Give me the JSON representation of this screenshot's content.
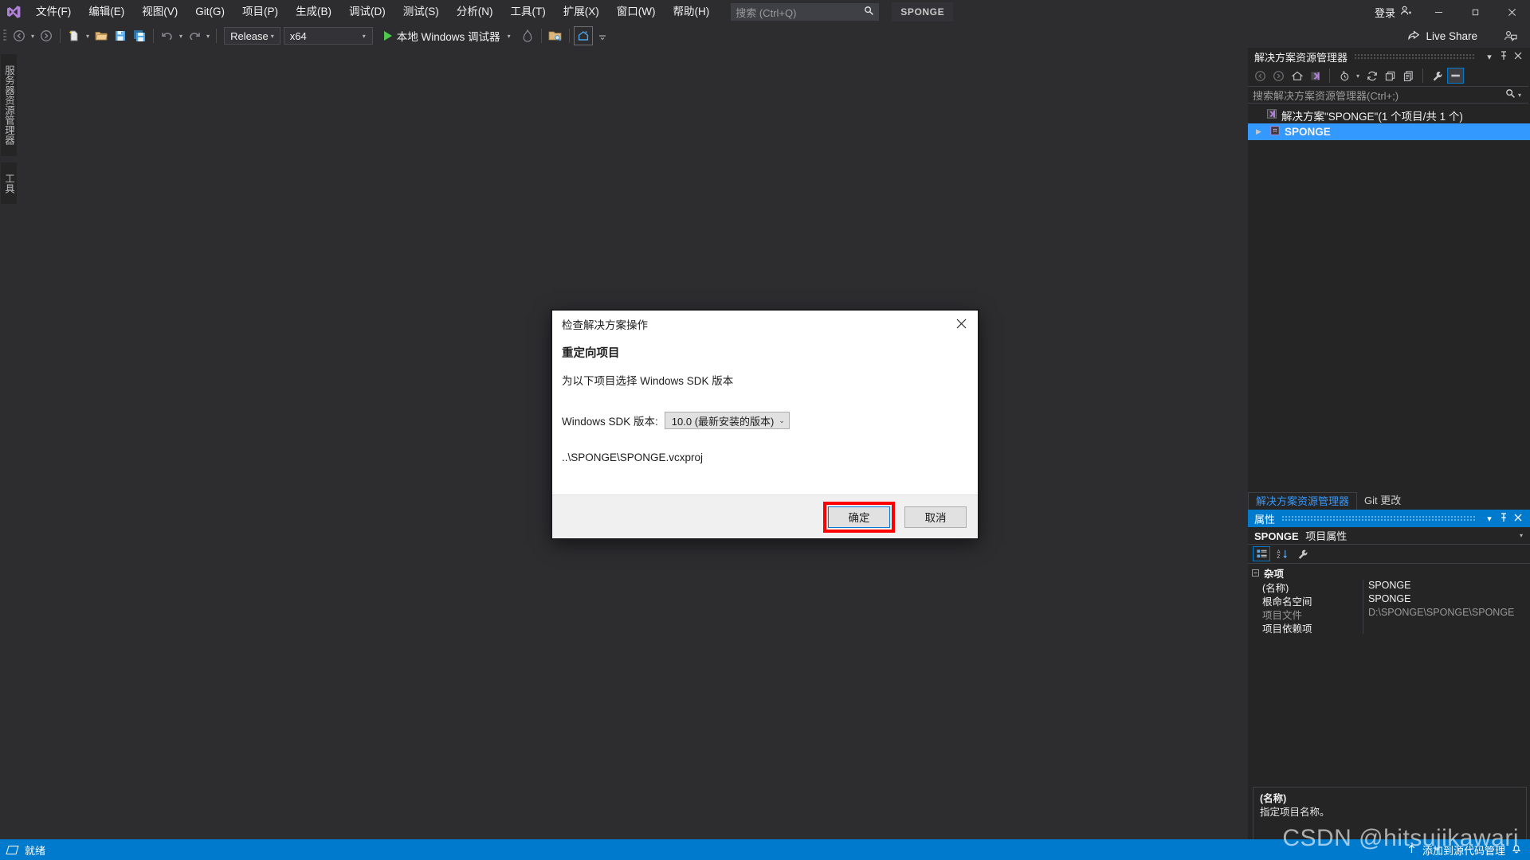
{
  "app": {
    "logo": "vs-logo",
    "project_pill": "SPONGE",
    "signin_label": "登录"
  },
  "menubar": {
    "items": [
      {
        "label": "文件(F)"
      },
      {
        "label": "编辑(E)"
      },
      {
        "label": "视图(V)"
      },
      {
        "label": "Git(G)"
      },
      {
        "label": "项目(P)"
      },
      {
        "label": "生成(B)"
      },
      {
        "label": "调试(D)"
      },
      {
        "label": "测试(S)"
      },
      {
        "label": "分析(N)"
      },
      {
        "label": "工具(T)"
      },
      {
        "label": "扩展(X)"
      },
      {
        "label": "窗口(W)"
      },
      {
        "label": "帮助(H)"
      }
    ]
  },
  "search": {
    "placeholder": "搜索 (Ctrl+Q)",
    "icon": "search-icon"
  },
  "window_controls": {
    "minimize": "—",
    "maximize": "❐",
    "close": "✕"
  },
  "toolbar": {
    "configuration": "Release",
    "platform": "x64",
    "run_label": "本地 Windows 调试器",
    "icons": [
      "back-icon",
      "forward-icon",
      "new-item-icon",
      "open-file-icon",
      "save-icon",
      "save-all-icon",
      "undo-icon",
      "redo-icon"
    ]
  },
  "live_share": {
    "label": "Live Share",
    "icon": "live-share-icon"
  },
  "left_rail": {
    "tabs": [
      {
        "label": "服务器资源管理器",
        "name": "server-explorer"
      },
      {
        "label": "工具箱",
        "name": "toolbox"
      }
    ]
  },
  "solution_explorer": {
    "title": "解决方案资源管理器",
    "search_placeholder": "搜索解决方案资源管理器(Ctrl+;)",
    "toolbar_icons": [
      "back-icon",
      "forward-icon",
      "home-icon",
      "switch-views-icon",
      "pending-changes-icon",
      "refresh-icon",
      "collapse-all-icon",
      "show-all-files-icon",
      "properties-icon",
      "preview-selected-icon"
    ],
    "tree": [
      {
        "label": "解决方案\"SPONGE\"(1 个项目/共 1 个)",
        "icon": "solution-icon",
        "selected": false
      },
      {
        "label": "SPONGE",
        "icon": "cpp-project-icon",
        "selected": true
      }
    ],
    "tabs": [
      {
        "label": "解决方案资源管理器",
        "active": true
      },
      {
        "label": "Git 更改",
        "active": false
      }
    ]
  },
  "properties": {
    "title": "属性",
    "object_name": "SPONGE",
    "object_kind": "项目属性",
    "toolbar_icons": [
      "categorized-icon",
      "alphabetical-icon",
      "property-pages-icon"
    ],
    "category": "杂项",
    "rows": [
      {
        "key": "(名称)",
        "value": "SPONGE",
        "dim": false
      },
      {
        "key": "根命名空间",
        "value": "SPONGE",
        "dim": false
      },
      {
        "key": "项目文件",
        "value": "D:\\SPONGE\\SPONGE\\SPONGE",
        "dim": true
      },
      {
        "key": "项目依赖项",
        "value": "",
        "dim": false
      }
    ],
    "description": {
      "title": "(名称)",
      "text": "指定项目名称。"
    }
  },
  "dialog": {
    "title": "检查解决方案操作",
    "heading": "重定向项目",
    "subtitle": "为以下项目选择 Windows SDK 版本",
    "sdk_label": "Windows SDK 版本:",
    "sdk_value": "10.0 (最新安装的版本)",
    "project_path": "..\\SPONGE\\SPONGE.vcxproj",
    "ok_label": "确定",
    "cancel_label": "取消",
    "close_icon": "close-icon",
    "highlight_color": "#fe0000",
    "focus_color": "#0078d7"
  },
  "statusbar": {
    "ready_label": "就绪",
    "source_control_label": "添加到源代码管理",
    "icon": "source-control-icon",
    "background": "#007acc"
  },
  "watermark": {
    "text": "CSDN @hitsujikawari"
  }
}
